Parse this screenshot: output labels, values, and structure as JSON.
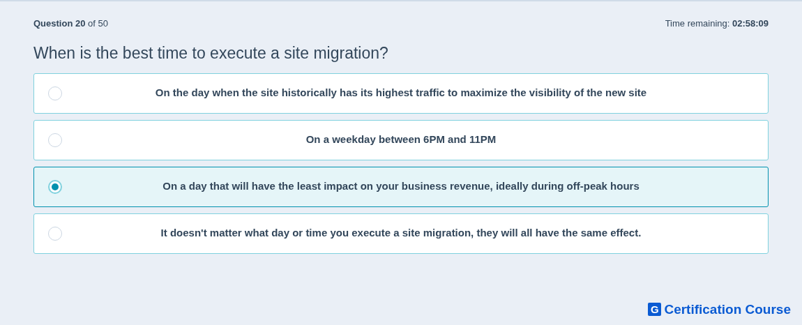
{
  "progress": "**Question 20** of 50",
  "timer": "Time remaining: **02:58:09**",
  "question": "When is the best time to execute a site migration?",
  "options": [
    {
      "label": "On the day when the site historically has its highest traffic to maximize the visibility of the new site",
      "selected": false
    },
    {
      "label": "On a weekday between 6PM and 11PM",
      "selected": false
    },
    {
      "label": "On a day that will have the least impact on your business revenue, ideally during off-peak hours",
      "selected": true
    },
    {
      "label": "It doesn't matter what day or time you execute a site migration, they will all have the same effect.",
      "selected": false
    }
  ],
  "brand": {
    "mark": "G",
    "name": "Certification Course"
  }
}
